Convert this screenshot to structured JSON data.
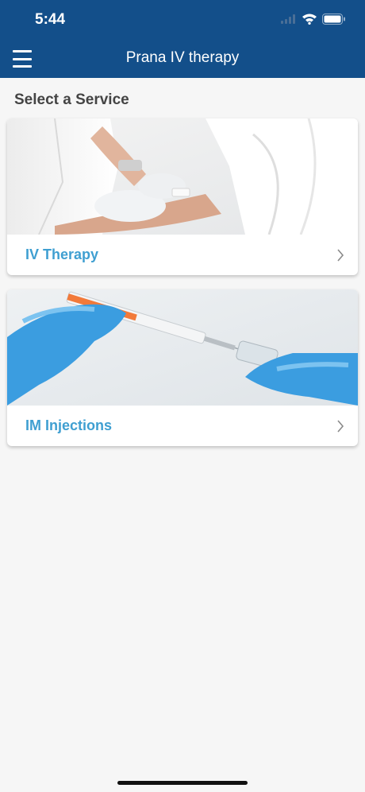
{
  "status_bar": {
    "time": "5:44"
  },
  "nav": {
    "title": "Prana IV therapy"
  },
  "main": {
    "section_title": "Select a Service",
    "services": [
      {
        "label": "IV Therapy"
      },
      {
        "label": "IM Injections"
      }
    ]
  },
  "colors": {
    "header": "#134f8a",
    "accent": "#3f9fd1",
    "background": "#f6f6f6"
  },
  "icons": [
    "menu-icon",
    "signal-icon",
    "wifi-icon",
    "battery-icon",
    "chevron-right-icon"
  ]
}
